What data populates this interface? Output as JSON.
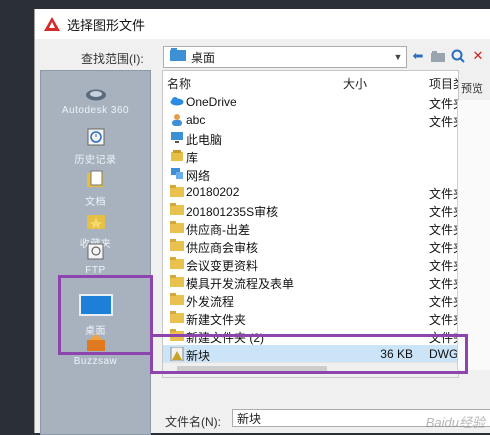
{
  "dialog": {
    "title": "选择图形文件"
  },
  "lookin": {
    "label": "查找范围(I):",
    "value": "桌面"
  },
  "places": [
    {
      "label": "Autodesk 360",
      "icon": "cloud-icon"
    },
    {
      "label": "历史记录",
      "icon": "history-icon"
    },
    {
      "label": "文档",
      "icon": "documents-icon"
    },
    {
      "label": "收藏夹",
      "icon": "favorites-icon"
    },
    {
      "label": "FTP",
      "icon": "ftp-icon"
    },
    {
      "label": "桌面",
      "icon": "desktop-icon"
    },
    {
      "label": "Buzzsaw",
      "icon": "buzzsaw-icon"
    }
  ],
  "columns": {
    "name": "名称",
    "size": "大小",
    "type": "项目类"
  },
  "files": [
    {
      "name": "OneDrive",
      "size": "",
      "type": "文件夹",
      "icon": "cloud-icon"
    },
    {
      "name": "abc",
      "size": "",
      "type": "文件夹",
      "icon": "user-icon"
    },
    {
      "name": "此电脑",
      "size": "",
      "type": "",
      "icon": "computer-icon"
    },
    {
      "name": "库",
      "size": "",
      "type": "",
      "icon": "library-icon"
    },
    {
      "name": "网络",
      "size": "",
      "type": "",
      "icon": "network-icon"
    },
    {
      "name": "20180202",
      "size": "",
      "type": "文件夹",
      "icon": "folder-icon"
    },
    {
      "name": "201801235S审核",
      "size": "",
      "type": "文件夹",
      "icon": "folder-icon"
    },
    {
      "name": "供应商-出差",
      "size": "",
      "type": "文件夹",
      "icon": "folder-icon"
    },
    {
      "name": "供应商会审核",
      "size": "",
      "type": "文件夹",
      "icon": "folder-icon"
    },
    {
      "name": "会议变更资料",
      "size": "",
      "type": "文件夹",
      "icon": "folder-icon"
    },
    {
      "name": "模具开发流程及表单",
      "size": "",
      "type": "文件夹",
      "icon": "folder-icon"
    },
    {
      "name": "外发流程",
      "size": "",
      "type": "文件夹",
      "icon": "folder-icon"
    },
    {
      "name": "新建文件夹",
      "size": "",
      "type": "文件夹",
      "icon": "folder-icon"
    },
    {
      "name": "新建文件夹 (2)",
      "size": "",
      "type": "文件夹",
      "icon": "folder-icon"
    },
    {
      "name": "新块",
      "size": "36 KB",
      "type": "DWG",
      "icon": "dwg-file-icon",
      "selected": true
    }
  ],
  "preview": {
    "label": "预览"
  },
  "filename": {
    "label": "文件名(N):",
    "value": "新块"
  },
  "watermark": "Baidu经验",
  "colors": {
    "highlight": "#8e44ad",
    "selection": "#cce4f7",
    "places_bg": "#a8b2bf"
  }
}
